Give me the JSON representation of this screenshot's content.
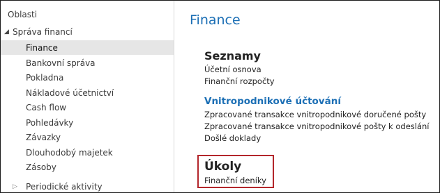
{
  "sidebar": {
    "root_label": "Oblasti",
    "group_label": "Správa financí",
    "items": [
      {
        "label": "Finance",
        "selected": true
      },
      {
        "label": "Bankovní správa"
      },
      {
        "label": "Pokladna"
      },
      {
        "label": "Nákladové účetnictví"
      },
      {
        "label": "Cash flow"
      },
      {
        "label": "Pohledávky"
      },
      {
        "label": "Závazky"
      },
      {
        "label": "Dlouhodobý majetek"
      },
      {
        "label": "Zásoby"
      }
    ],
    "collapsed_label": "Periodické aktivity"
  },
  "main": {
    "title": "Finance",
    "sections": [
      {
        "title": "Seznamy",
        "links": [
          "Účetní osnova",
          "Finanční rozpočty"
        ]
      },
      {
        "title": "Vnitropodnikové účtování",
        "links": [
          "Zpracované transakce vnitropodnikové doručené pošty",
          "Zpracované transakce vnitropodnikové pošty k odeslání",
          "Došlé doklady"
        ]
      },
      {
        "title": "Úkoly",
        "links": [
          "Finanční deníky"
        ]
      }
    ]
  },
  "colors": {
    "accent": "#1c6fb5",
    "highlight": "#b3262b",
    "selected_bg": "#e6e6e6"
  }
}
